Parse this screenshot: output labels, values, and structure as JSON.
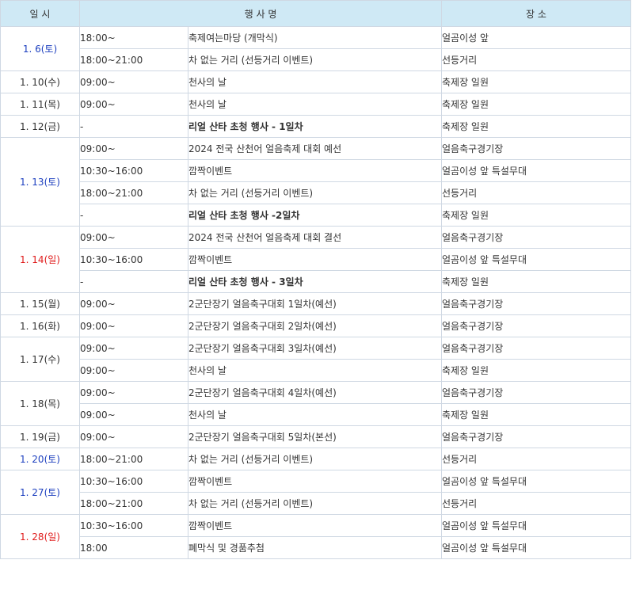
{
  "headers": {
    "date": "일 시",
    "event": "행 사 명",
    "place": "장 소"
  },
  "groups": [
    {
      "date": "1. 6(토)",
      "color": "sat",
      "rows": [
        {
          "time": "18:00~",
          "event": "축제여는마당 (개막식)",
          "place": "얼곰이성 앞"
        },
        {
          "time": "18:00~21:00",
          "event": "차 없는 거리 (선등거리 이벤트)",
          "place": "선등거리"
        }
      ]
    },
    {
      "date": "1. 10(수)",
      "color": "wk",
      "rows": [
        {
          "time": "09:00~",
          "event": "천사의 날",
          "place": "축제장 일원"
        }
      ]
    },
    {
      "date": "1. 11(목)",
      "color": "wk",
      "rows": [
        {
          "time": "09:00~",
          "event": "천사의 날",
          "place": "축제장 일원"
        }
      ]
    },
    {
      "date": "1. 12(금)",
      "color": "wk",
      "rows": [
        {
          "time": "-",
          "event": "리얼 산타 초청 행사 - 1일차",
          "place": "축제장 일원",
          "bold": true
        }
      ]
    },
    {
      "date": "1. 13(토)",
      "color": "sat",
      "rows": [
        {
          "time": "09:00~",
          "event": "2024 전국 산천어 얼음축제 대회 예선",
          "place": "얼음축구경기장"
        },
        {
          "time": "10:30~16:00",
          "event": "깜짝이벤트",
          "place": "얼곰이성 앞 특설무대"
        },
        {
          "time": "18:00~21:00",
          "event": "차 없는 거리 (선등거리 이벤트)",
          "place": "선등거리"
        },
        {
          "time": "-",
          "event": "리얼 산타 초청 행사 -2일차",
          "place": "축제장 일원",
          "bold": true
        }
      ]
    },
    {
      "date": "1. 14(일)",
      "color": "sun",
      "rows": [
        {
          "time": "09:00~",
          "event": "2024 전국 산천어 얼음축제 대회 결선",
          "place": "얼음축구경기장"
        },
        {
          "time": "10:30~16:00",
          "event": "깜짝이벤트",
          "place": "얼곰이성 앞 특설무대"
        },
        {
          "time": "-",
          "event": "리얼 산타 초청 행사 - 3일차",
          "place": "축제장 일원",
          "bold": true
        }
      ]
    },
    {
      "date": "1. 15(월)",
      "color": "wk",
      "rows": [
        {
          "time": "09:00~",
          "event": "2군단장기 얼음축구대회 1일차(예선)",
          "place": "얼음축구경기장"
        }
      ]
    },
    {
      "date": "1. 16(화)",
      "color": "wk",
      "rows": [
        {
          "time": "09:00~",
          "event": "2군단장기 얼음축구대회 2일차(예선)",
          "place": "얼음축구경기장"
        }
      ]
    },
    {
      "date": "1. 17(수)",
      "color": "wk",
      "rows": [
        {
          "time": "09:00~",
          "event": "2군단장기 얼음축구대회 3일차(예선)",
          "place": "얼음축구경기장"
        },
        {
          "time": "09:00~",
          "event": "천사의 날",
          "place": "축제장 일원"
        }
      ]
    },
    {
      "date": "1. 18(목)",
      "color": "wk",
      "rows": [
        {
          "time": "09:00~",
          "event": "2군단장기 얼음축구대회 4일차(예선)",
          "place": "얼음축구경기장"
        },
        {
          "time": "09:00~",
          "event": "천사의 날",
          "place": "축제장 일원"
        }
      ]
    },
    {
      "date": "1. 19(금)",
      "color": "wk",
      "rows": [
        {
          "time": "09:00~",
          "event": "2군단장기 얼음축구대회 5일차(본선)",
          "place": "얼음축구경기장"
        }
      ]
    },
    {
      "date": "1. 20(토)",
      "color": "sat",
      "rows": [
        {
          "time": "18:00~21:00",
          "event": "차 없는 거리 (선등거리 이벤트)",
          "place": "선등거리"
        }
      ]
    },
    {
      "date": "1. 27(토)",
      "color": "sat",
      "rows": [
        {
          "time": "10:30~16:00",
          "event": "깜짝이벤트",
          "place": "얼곰이성 앞 특설무대"
        },
        {
          "time": "18:00~21:00",
          "event": "차 없는 거리 (선등거리 이벤트)",
          "place": "선등거리"
        }
      ]
    },
    {
      "date": "1. 28(일)",
      "color": "sun",
      "rows": [
        {
          "time": "10:30~16:00",
          "event": "깜짝이벤트",
          "place": "얼곰이성 앞 특설무대"
        },
        {
          "time": "18:00",
          "event": "폐막식 및 경품추첨",
          "place": "얼곰이성 앞 특설무대"
        }
      ]
    }
  ]
}
